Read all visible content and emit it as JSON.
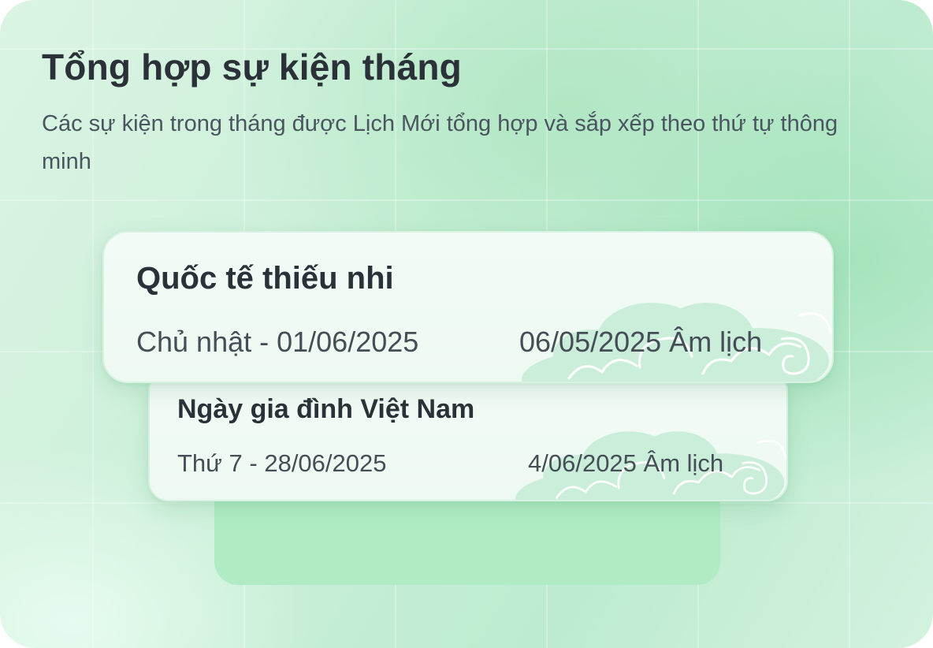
{
  "header": {
    "title": "Tổng hợp sự kiện tháng",
    "subtitle": "Các sự kiện trong tháng được Lịch Mới tổng hợp và sắp xếp theo thứ tự thông minh"
  },
  "events": [
    {
      "name": "Quốc tế thiếu nhi",
      "solar_date": "Chủ nhật - 01/06/2025",
      "lunar_date": "06/05/2025 Âm lịch"
    },
    {
      "name": "Ngày gia đình Việt Nam",
      "solar_date": "Thứ 7 - 28/06/2025",
      "lunar_date": "4/06/2025 Âm lịch"
    }
  ],
  "colors": {
    "background_green": "#c8efd6",
    "card_background": "#f3fbf6",
    "back_card": "#b0ebc6",
    "title_text": "#2b3138",
    "body_text": "#454e57"
  },
  "icons": [
    "cloud-pattern-icon"
  ]
}
